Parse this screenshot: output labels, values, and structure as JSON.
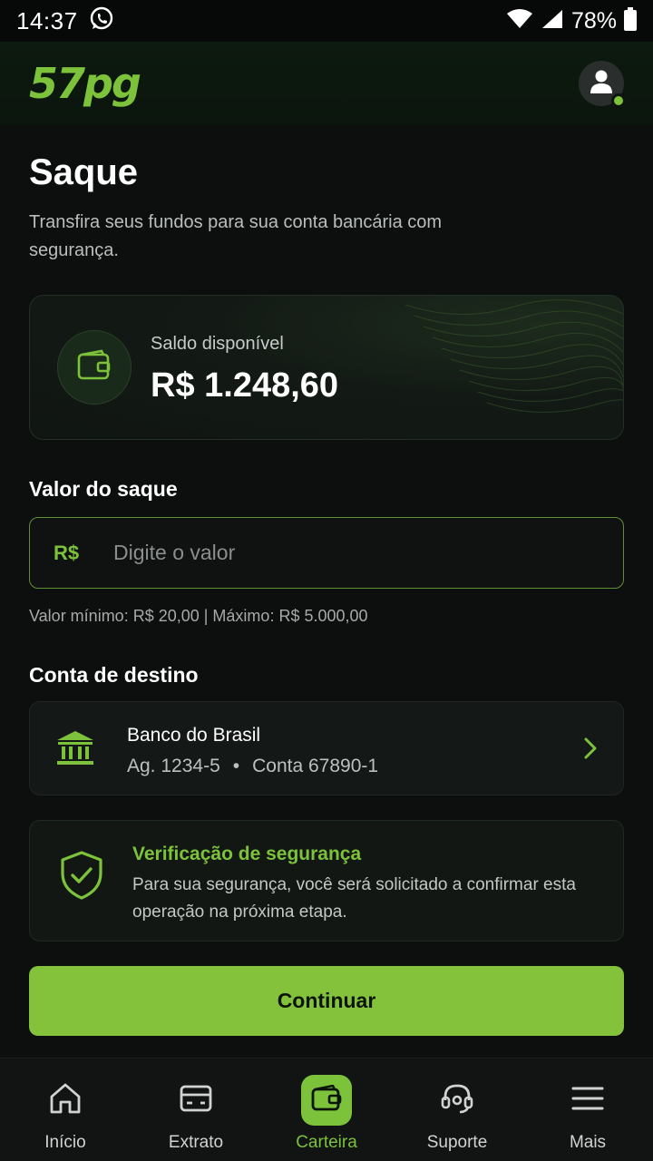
{
  "status_bar": {
    "time": "14:37",
    "battery": "78%"
  },
  "header": {
    "logo": "57pg",
    "accent_color": "#7cc23a"
  },
  "page": {
    "title": "Saque",
    "subtitle": "Transfira seus fundos para sua conta bancária com segurança."
  },
  "balance": {
    "label": "Saldo disponível",
    "value": "R$ 1.248,60"
  },
  "withdraw": {
    "section_label": "Valor do saque",
    "currency": "R$",
    "placeholder": "Digite o valor",
    "limits": "Valor mínimo: R$ 20,00 | Máximo: R$ 5.000,00"
  },
  "destination": {
    "section_label": "Conta de destino",
    "bank_name": "Banco do Brasil",
    "agency": "Ag. 1234-5",
    "separator": "•",
    "account": "Conta 67890-1"
  },
  "security": {
    "title": "Verificação de segurança",
    "text": "Para sua segurança, você será solicitado a confirmar esta operação na próxima etapa."
  },
  "continue_label": "Continuar",
  "nav": {
    "items": [
      {
        "label": "Início",
        "icon": "home-icon",
        "active": false
      },
      {
        "label": "Extrato",
        "icon": "card-icon",
        "active": false
      },
      {
        "label": "Carteira",
        "icon": "wallet-icon",
        "active": true
      },
      {
        "label": "Suporte",
        "icon": "headset-icon",
        "active": false
      },
      {
        "label": "Mais",
        "icon": "menu-icon",
        "active": false
      }
    ]
  }
}
